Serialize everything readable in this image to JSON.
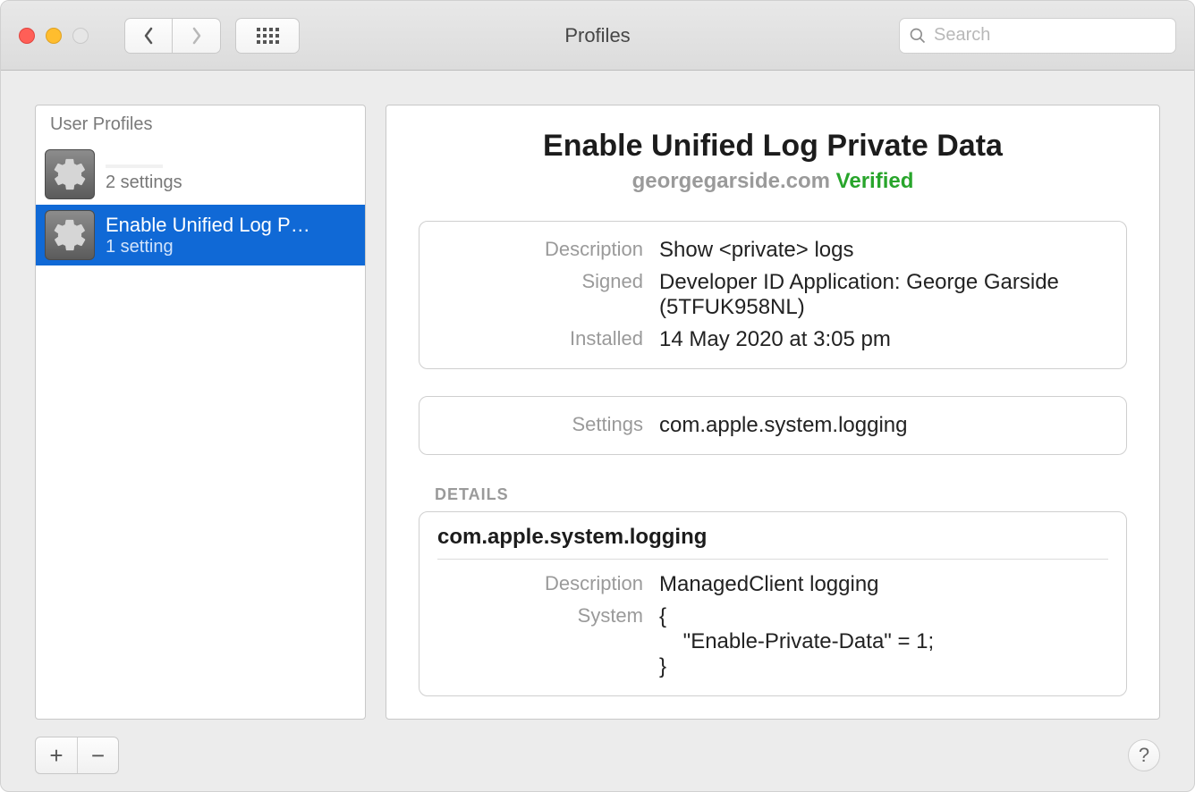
{
  "window": {
    "title": "Profiles"
  },
  "search": {
    "placeholder": "Search",
    "value": ""
  },
  "sidebar": {
    "header": "User Profiles",
    "items": [
      {
        "name": "",
        "sub": "2 settings",
        "selected": false
      },
      {
        "name": "Enable Unified Log P…",
        "sub": "1 setting",
        "selected": true
      }
    ]
  },
  "main": {
    "title": "Enable Unified Log Private Data",
    "domain": "georgegarside.com",
    "verified": "Verified",
    "info": {
      "description_label": "Description",
      "description_value": "Show <private> logs",
      "signed_label": "Signed",
      "signed_value": "Developer ID Application: George Garside (5TFUK958NL)",
      "installed_label": "Installed",
      "installed_value": "14 May 2020 at 3:05 pm"
    },
    "settings": {
      "label": "Settings",
      "value": "com.apple.system.logging"
    },
    "details_label": "DETAILS",
    "details": {
      "header": "com.apple.system.logging",
      "description_label": "Description",
      "description_value": "ManagedClient logging",
      "system_label": "System",
      "system_value": "{\n    \"Enable-Private-Data\" = 1;\n}"
    }
  },
  "buttons": {
    "add": "+",
    "remove": "−",
    "help": "?"
  }
}
